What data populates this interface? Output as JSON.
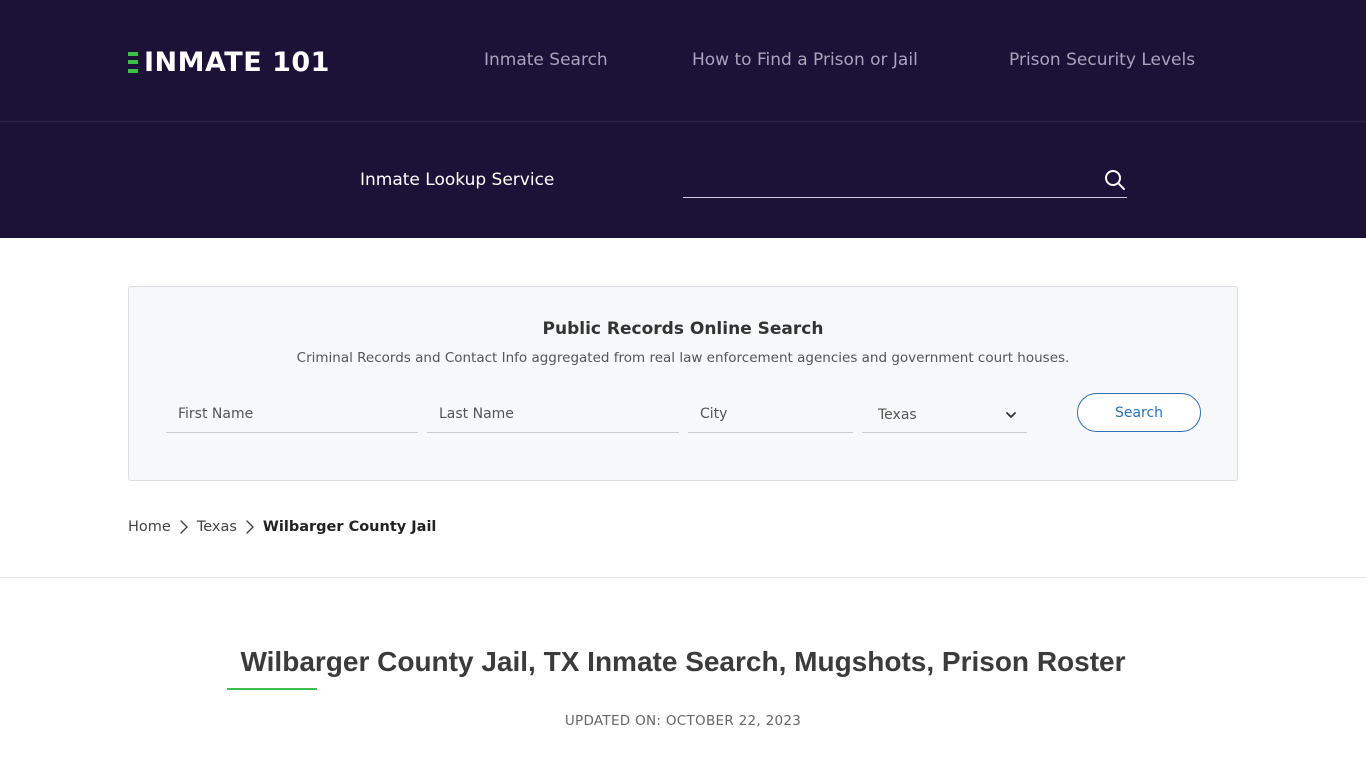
{
  "header": {
    "logo_text": "INMATE 101",
    "nav": [
      {
        "label": "Inmate Search"
      },
      {
        "label": "How to Find a Prison or Jail"
      },
      {
        "label": "Prison Security Levels"
      }
    ],
    "lookup_label": "Inmate Lookup Service",
    "lookup_search_placeholder": ""
  },
  "records_search": {
    "title": "Public Records Online Search",
    "subtitle": "Criminal Records and Contact Info aggregated from real law enforcement agencies and government court houses.",
    "first_name_placeholder": "First Name",
    "last_name_placeholder": "Last Name",
    "city_placeholder": "City",
    "state_selected": "Texas",
    "search_label": "Search"
  },
  "breadcrumb": {
    "home": "Home",
    "state": "Texas",
    "current": "Wilbarger County Jail"
  },
  "main": {
    "title": "Wilbarger County Jail, TX Inmate Search, Mugshots, Prison Roster",
    "updated": "UPDATED ON: OCTOBER 22, 2023"
  },
  "colors": {
    "header_bg": "#1c1238",
    "accent_green": "#3fbf4a",
    "button_blue": "#2d6fb3"
  }
}
